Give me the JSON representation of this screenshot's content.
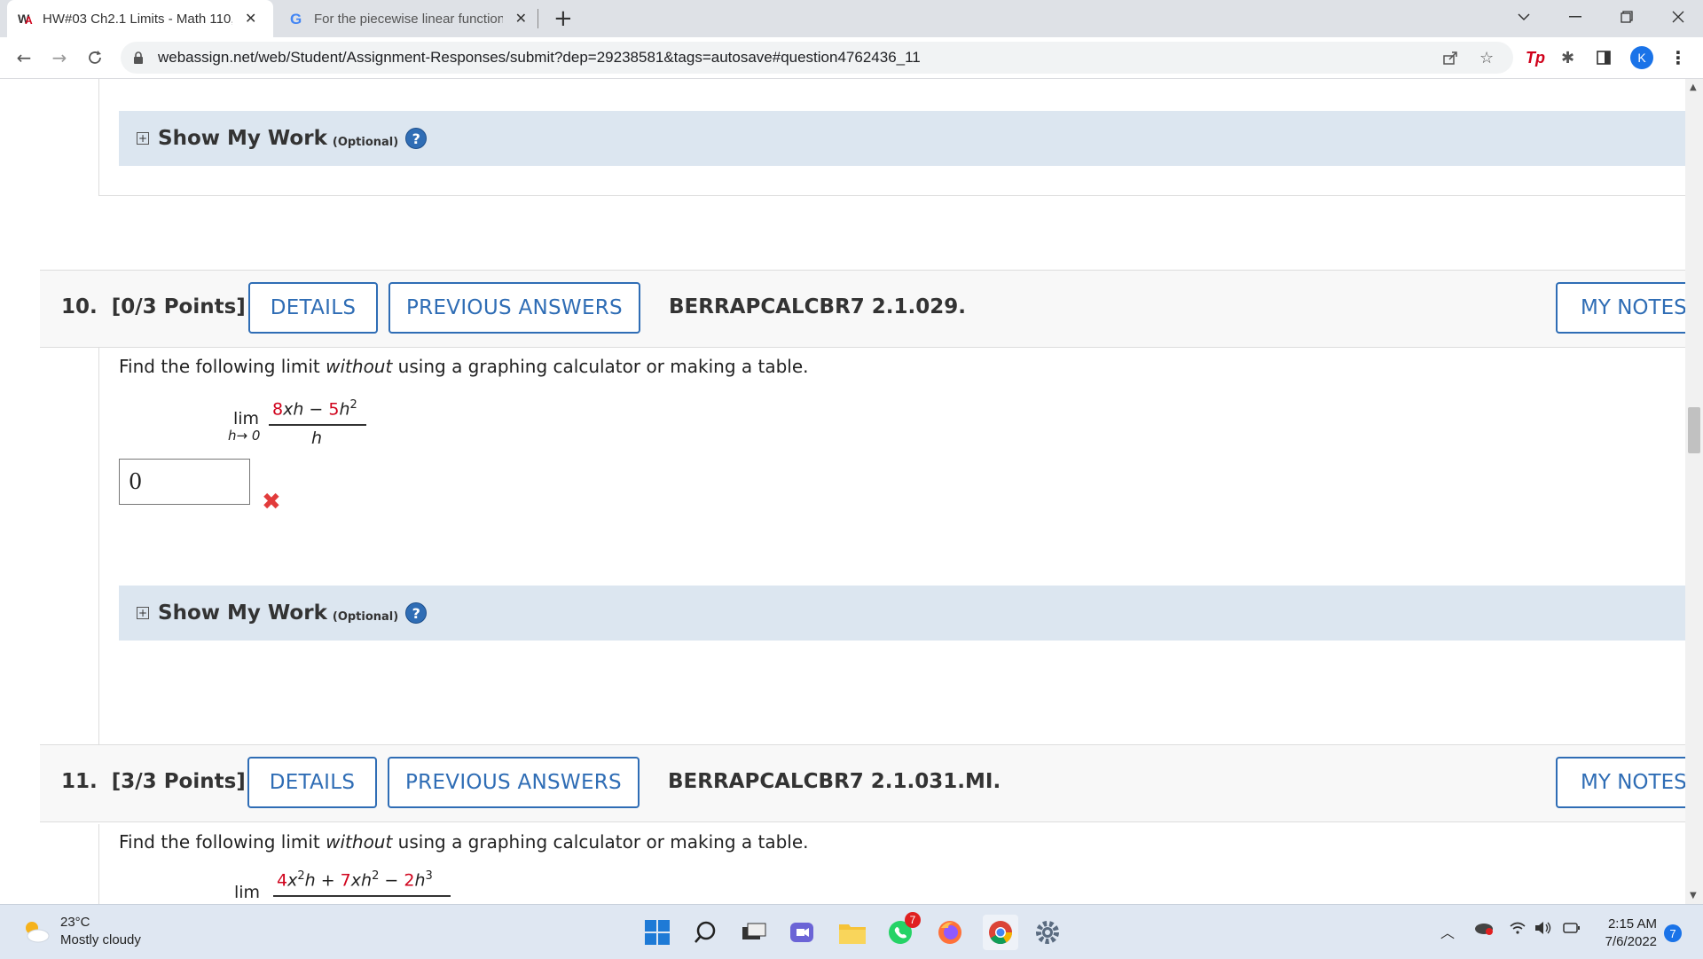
{
  "browser": {
    "tabs": [
      {
        "title": "HW#03 Ch2.1 Limits - Math 110,",
        "favicon": "webassign-icon",
        "active": true
      },
      {
        "title": "For the piecewise linear function",
        "favicon": "google-icon",
        "active": false
      }
    ],
    "url": "webassign.net/web/Student/Assignment-Responses/submit?dep=29238581&tags=autosave#question4762436_11",
    "profile_initial": "K",
    "extension_label": "Tp"
  },
  "questions": {
    "prev": {
      "show_my_work": "Show My Work",
      "optional": "(Optional)",
      "help": "?"
    },
    "q10": {
      "number": "10.",
      "points": "[0/3 Points]",
      "details_label": "DETAILS",
      "previous_answers_label": "PREVIOUS ANSWERS",
      "reference": "BERRAPCALCBR7 2.1.029.",
      "my_notes_label": "MY NOTES",
      "prompt_before": "Find the following limit ",
      "prompt_emph": "without",
      "prompt_after": " using a graphing calculator or making a table.",
      "math": {
        "lim": "lim",
        "sub": "h→ 0",
        "coef1": "8",
        "var1": "xh",
        "op": " − ",
        "coef2": "5",
        "var2": "h",
        "exp2": "2",
        "den": "h"
      },
      "answer_value": "0",
      "answer_status": "incorrect",
      "wrong_icon": "✖",
      "show_my_work": "Show My Work",
      "optional": "(Optional)",
      "help": "?"
    },
    "q11": {
      "number": "11.",
      "points": "[3/3 Points]",
      "details_label": "DETAILS",
      "previous_answers_label": "PREVIOUS ANSWERS",
      "reference": "BERRAPCALCBR7 2.1.031.MI.",
      "my_notes_label": "MY NOTES",
      "prompt_before": "Find the following limit ",
      "prompt_emph": "without",
      "prompt_after": " using a graphing calculator or making a table.",
      "math": {
        "lim": "lim",
        "coef1": "4",
        "var1a": "x",
        "exp1": "2",
        "var1b": "h",
        "op1": " + ",
        "coef2": "7",
        "var2": "xh",
        "exp2": "2",
        "op2": " − ",
        "coef3": "2",
        "var3": "h",
        "exp3": "3"
      }
    }
  },
  "taskbar": {
    "temperature": "23°C",
    "weather": "Mostly cloudy",
    "whatsapp_badge": "7",
    "time": "2:15 AM",
    "date": "7/6/2022",
    "notifications": "7"
  },
  "colors": {
    "accent_blue": "#2f6db5",
    "answer_red": "#d0021b",
    "wrong_x": "#e23b3b",
    "smw_bar": "#dce6f0"
  }
}
